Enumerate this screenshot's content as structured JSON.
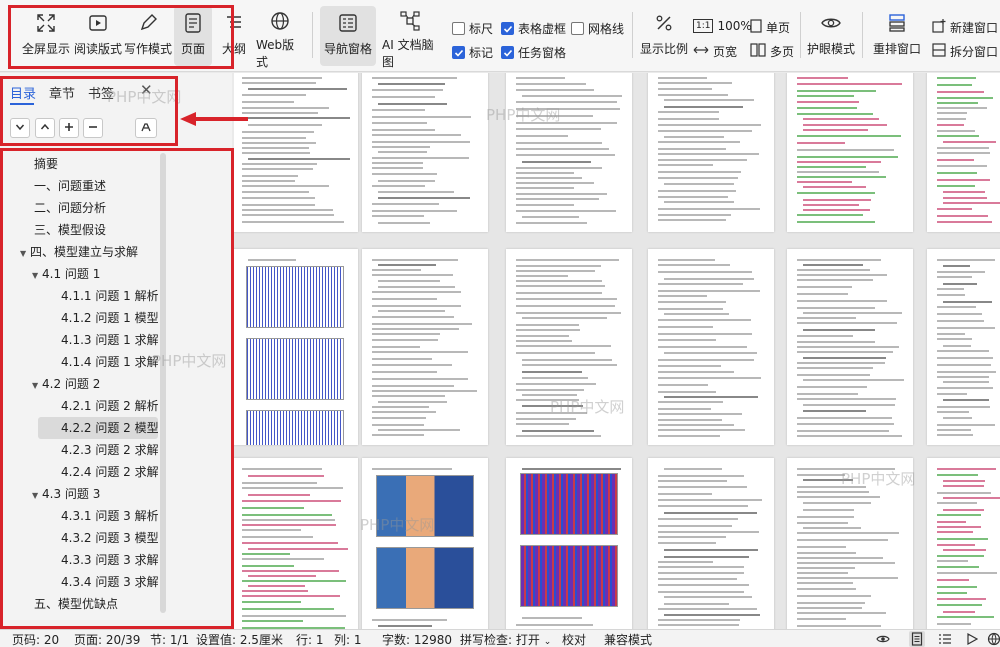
{
  "toolbar": {
    "fullscreen": "全屏显示",
    "reading_mode": "阅读版式",
    "writing_mode": "写作模式",
    "page": "页面",
    "outline": "大纲",
    "web_layout": "Web版式",
    "nav_pane": "导航窗格",
    "ai_mindmap": "AI 文档脑图",
    "ruler": "标尺",
    "table_gridlines": "表格虚框",
    "gridlines": "网格线",
    "marks": "标记",
    "task_pane": "任务窗格",
    "display_ratio": "显示比例",
    "zoom_100": "100%",
    "page_width": "页宽",
    "single_page": "单页",
    "multi_page": "多页",
    "eye_protect": "护眼模式",
    "rearrange_window": "重排窗口",
    "new_window": "新建窗口",
    "split_window": "拆分窗口"
  },
  "nav": {
    "tabs": [
      "目录",
      "章节",
      "书签"
    ],
    "items": [
      "摘要",
      "一、问题重述",
      "二、问题分析",
      "三、模型假设",
      "四、模型建立与求解",
      "4.1 问题 1",
      "4.1.1 问题 1 解析",
      "4.1.2 问题 1 模型...",
      "4.1.3 问题 1 求解...",
      "4.1.4 问题 1 求解...",
      "4.2 问题 2",
      "4.2.1 问题 2 解析",
      "4.2.2 问题 2 模型...",
      "4.2.3 问题 2 求解...",
      "4.2.4 问题 2 求解...",
      "4.3 问题 3",
      "4.3.1 问题 3 解析",
      "4.3.2 问题 3 模型...",
      "4.3.3 问题 3 求解...",
      "4.3.4 问题 3 求解...",
      "五、模型优缺点"
    ]
  },
  "watermark": "PHP中文网",
  "status": {
    "page_num": "页码: 20",
    "page_of": "页面: 20/39",
    "section": "节: 1/1",
    "setting": "设置值: 2.5厘米",
    "row": "行: 1",
    "col": "列: 1",
    "word_count": "字数: 12980",
    "spell_check": "拼写检查: 打开",
    "proofread": "校对",
    "compat_mode": "兼容模式"
  },
  "colors": {
    "accent": "#2b63d9",
    "annotation": "#d8232a"
  }
}
